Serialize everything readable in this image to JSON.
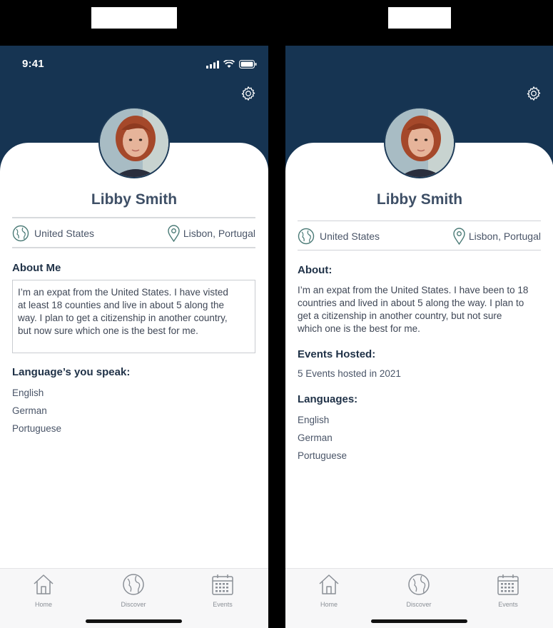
{
  "colors": {
    "header": "#163452",
    "name": "#3e4f66",
    "icon": "#4a7a76"
  },
  "before": {
    "status_time": "9:41",
    "profile": {
      "name": "Libby Smith",
      "country": "United States",
      "location": "Lisbon, Portugal"
    },
    "about": {
      "title": "About Me",
      "lines": [
        "I’m an expat from the United States. I have visted",
        "at least 18 counties and live in about 5 along the",
        "way. I plan to get a citizenship in another country,",
        "but now sure which one is the best for me."
      ]
    },
    "languages": {
      "title": "Language’s you speak:",
      "items": [
        "English",
        "German",
        "Portuguese"
      ]
    }
  },
  "after": {
    "profile": {
      "name": "Libby Smith",
      "country": "United States",
      "location": "Lisbon, Portugal"
    },
    "about": {
      "title": "About:",
      "lines": [
        "I’m an expat from the United States. I have been to 18",
        "countries and lived in about 5 along the way. I plan to",
        "get a citizenship in another country, but not sure",
        "which one is the best for me."
      ]
    },
    "events": {
      "title": "Events Hosted:",
      "value": "5 Events hosted in 2021"
    },
    "languages": {
      "title": "Languages:",
      "items": [
        "English",
        "German",
        "Portuguese"
      ]
    }
  },
  "tabs": [
    {
      "label": "Home",
      "icon": "home-icon"
    },
    {
      "label": "Discover",
      "icon": "globe-icon"
    },
    {
      "label": "Events",
      "icon": "calendar-icon"
    }
  ]
}
